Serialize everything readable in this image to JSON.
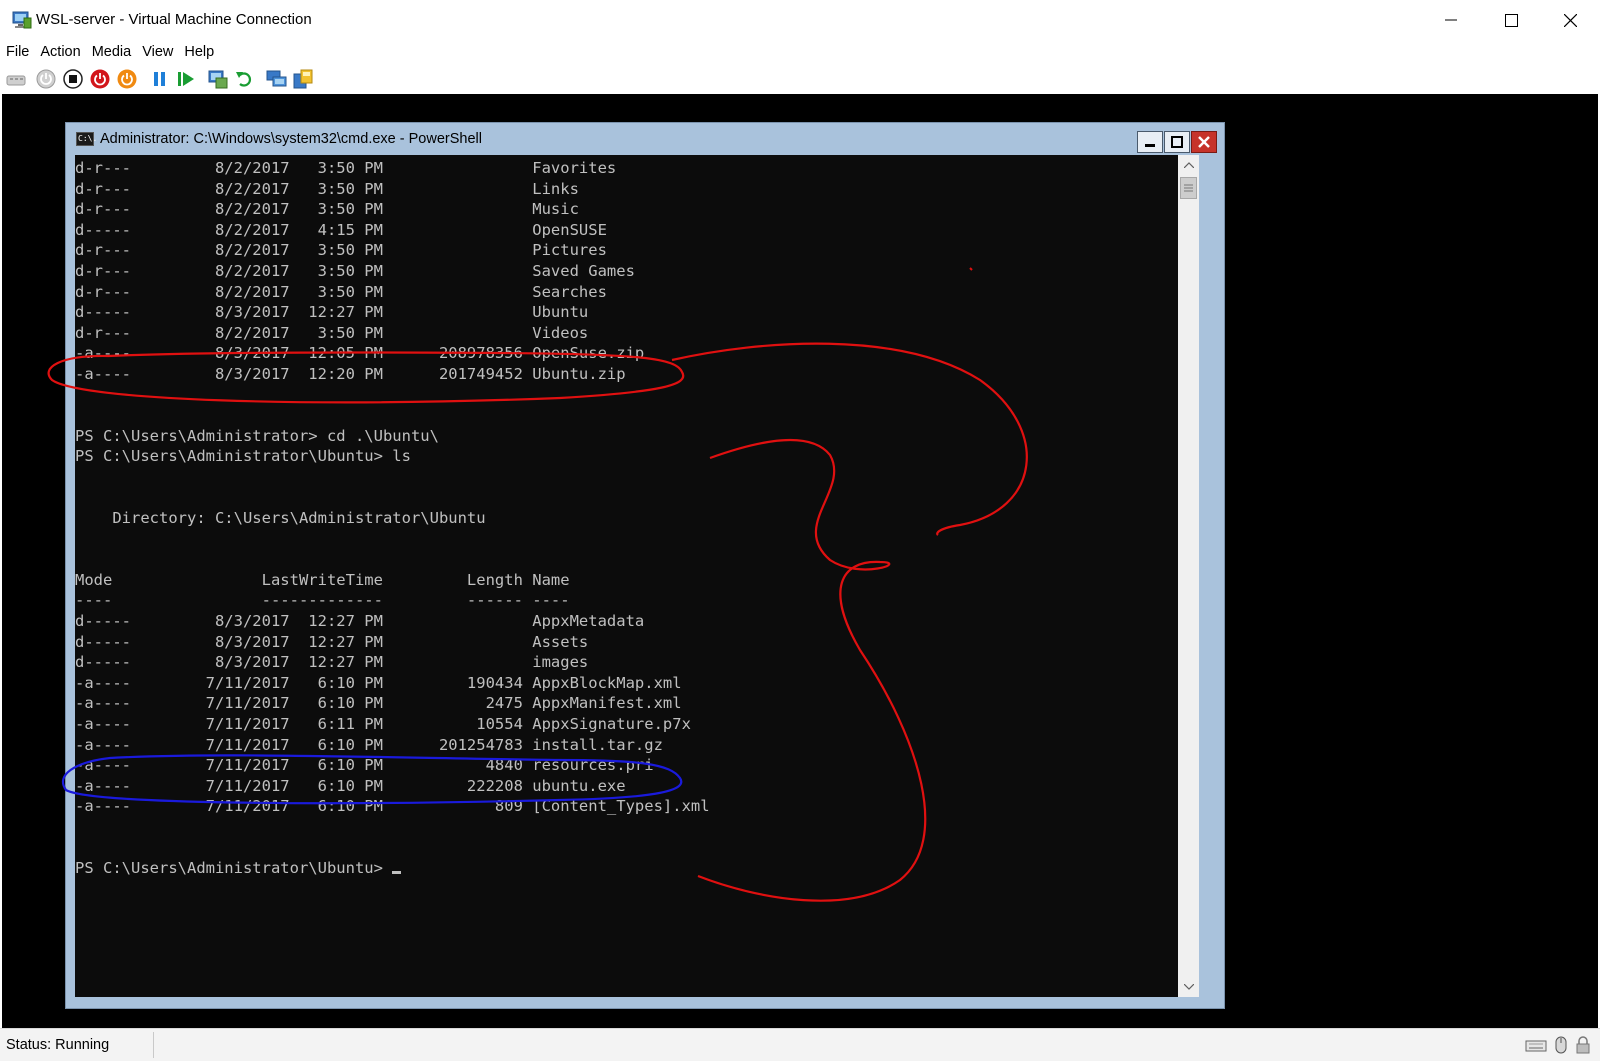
{
  "window": {
    "title": "WSL-server - Virtual Machine Connection",
    "controls": [
      "minimize",
      "maximize",
      "close"
    ]
  },
  "menu": {
    "items": [
      "File",
      "Action",
      "Media",
      "View",
      "Help"
    ]
  },
  "toolbar": {
    "icons": [
      "ctrl-alt-del-icon",
      "start-icon",
      "turn-off-icon",
      "shut-down-icon",
      "save-icon",
      "pause-icon",
      "resume-icon",
      "checkpoint-icon",
      "revert-icon",
      "enhanced-session-icon",
      "share-icon"
    ]
  },
  "cmd_window": {
    "title": "Administrator: C:\\Windows\\system32\\cmd.exe - PowerShell",
    "icon_label": "C:\\."
  },
  "console": {
    "lines": [
      "d-r---         8/2/2017   3:50 PM                Favorites",
      "d-r---         8/2/2017   3:50 PM                Links",
      "d-r---         8/2/2017   3:50 PM                Music",
      "d-----         8/2/2017   4:15 PM                OpenSUSE",
      "d-r---         8/2/2017   3:50 PM                Pictures",
      "d-r---         8/2/2017   3:50 PM                Saved Games",
      "d-r---         8/2/2017   3:50 PM                Searches",
      "d-----         8/3/2017  12:27 PM                Ubuntu",
      "d-r---         8/2/2017   3:50 PM                Videos",
      "-a----         8/3/2017  12:05 PM      208978356 OpenSuse.zip",
      "-a----         8/3/2017  12:20 PM      201749452 Ubuntu.zip",
      "",
      "",
      "PS C:\\Users\\Administrator> cd .\\Ubuntu\\",
      "PS C:\\Users\\Administrator\\Ubuntu> ls",
      "",
      "",
      "    Directory: C:\\Users\\Administrator\\Ubuntu",
      "",
      "",
      "Mode                LastWriteTime         Length Name",
      "----                -------------         ------ ----",
      "d-----         8/3/2017  12:27 PM                AppxMetadata",
      "d-----         8/3/2017  12:27 PM                Assets",
      "d-----         8/3/2017  12:27 PM                images",
      "-a----        7/11/2017   6:10 PM         190434 AppxBlockMap.xml",
      "-a----        7/11/2017   6:10 PM           2475 AppxManifest.xml",
      "-a----        7/11/2017   6:11 PM          10554 AppxSignature.p7x",
      "-a----        7/11/2017   6:10 PM      201254783 install.tar.gz",
      "-a----        7/11/2017   6:10 PM           4840 resources.pri",
      "-a----        7/11/2017   6:10 PM         222208 ubuntu.exe",
      "-a----        7/11/2017   6:10 PM            809 [Content_Types].xml",
      "",
      ""
    ],
    "prompt": "PS C:\\Users\\Administrator\\Ubuntu> "
  },
  "status": {
    "text": "Status: Running",
    "icons": [
      "keyboard-icon",
      "mouse-icon",
      "lock-icon"
    ]
  },
  "colors": {
    "console_bg": "#0c0c0c",
    "console_fg": "#c0c0c0",
    "cmd_frame": "#a9c2dc",
    "annotation_red": "#e01010",
    "annotation_blue": "#1a1adc"
  }
}
